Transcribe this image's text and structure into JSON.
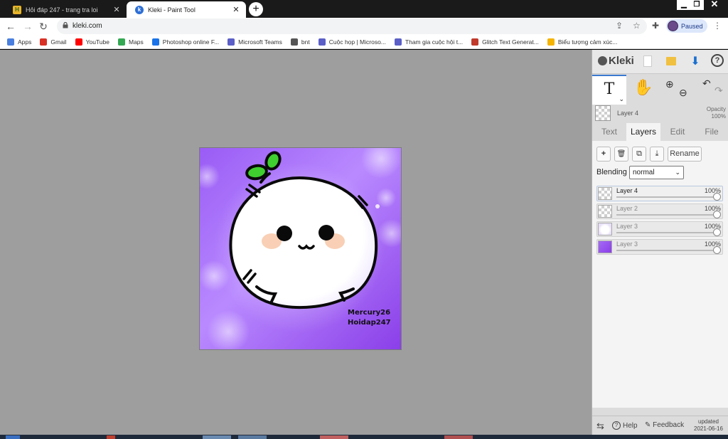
{
  "browser": {
    "tabs": [
      {
        "title": "Hỏi đáp 247 - trang tra loi",
        "close": "✕"
      },
      {
        "title": "Kleki - Paint Tool",
        "close": "✕"
      }
    ],
    "new_tab": "+",
    "window": {
      "minimize": "▁",
      "maximize": "❐",
      "close": "✕"
    },
    "nav": {
      "back": "←",
      "forward": "→",
      "reload": "↻"
    },
    "url": "kleki.com",
    "share": "⇪",
    "star": "☆",
    "extensions": "✚",
    "profile_status": "Paused",
    "menu": "⋮",
    "bookmarks": [
      {
        "label": "Apps",
        "color": "#4a7fe0"
      },
      {
        "label": "Gmail",
        "color": "#d93025"
      },
      {
        "label": "YouTube",
        "color": "#ff0000"
      },
      {
        "label": "Maps",
        "color": "#34a853"
      },
      {
        "label": "Photoshop online F...",
        "color": "#1a73e8"
      },
      {
        "label": "Microsoft Teams",
        "color": "#5b5fc7"
      },
      {
        "label": "bnt",
        "color": "#555555"
      },
      {
        "label": "Cuộc họp | Microso...",
        "color": "#5b5fc7"
      },
      {
        "label": "Tham gia cuộc hội t...",
        "color": "#5b5fc7"
      },
      {
        "label": "Glitch Text Generat...",
        "color": "#c0392b"
      },
      {
        "label": "Biểu tượng cảm xúc...",
        "color": "#f5b400"
      }
    ]
  },
  "artwork": {
    "signature_line1": "Mercury26",
    "signature_line2": "Hoidap247",
    "colors": {
      "bg_light": "#c9a6ff",
      "bg_dark": "#9a4cf0",
      "leaf": "#3fcf2f",
      "blush": "#f8c8a8"
    }
  },
  "panel": {
    "logo": "Kleki",
    "save_icon": "⬇",
    "help_icon": "?",
    "tools": {
      "text": "T",
      "text_chevron": "⌄",
      "hand": "✋",
      "zoom_in": "⊕",
      "zoom_out": "⊖",
      "undo": "↶",
      "redo": "↷"
    },
    "current_layer": {
      "name": "Layer 4",
      "opacity_label": "Opacity",
      "opacity_value": "100%"
    },
    "tabs": [
      "Text",
      "Layers",
      "Edit",
      "File"
    ],
    "layer_buttons": {
      "add": "+",
      "delete": "🗑",
      "duplicate": "⧉",
      "merge": "⤓",
      "rename": "Rename"
    },
    "blending_label": "Blending",
    "blending_value": "normal",
    "blending_caret": "⌄",
    "layers": [
      {
        "name": "Layer 4",
        "opacity": "100%",
        "opacity_fraction": 1.0,
        "active": true
      },
      {
        "name": "Layer 2",
        "opacity": "100%",
        "opacity_fraction": 1.0,
        "active": false
      },
      {
        "name": "Layer 3",
        "opacity": "100%",
        "opacity_fraction": 1.0,
        "active": false
      },
      {
        "name": "Layer 3",
        "opacity": "100%",
        "opacity_fraction": 1.0,
        "active": false
      }
    ],
    "footer": {
      "swap": "⇆",
      "help": "Help",
      "help_q": "?",
      "feedback": "Feedback",
      "updated_label": "updated",
      "updated_date": "2021-06-16"
    }
  }
}
